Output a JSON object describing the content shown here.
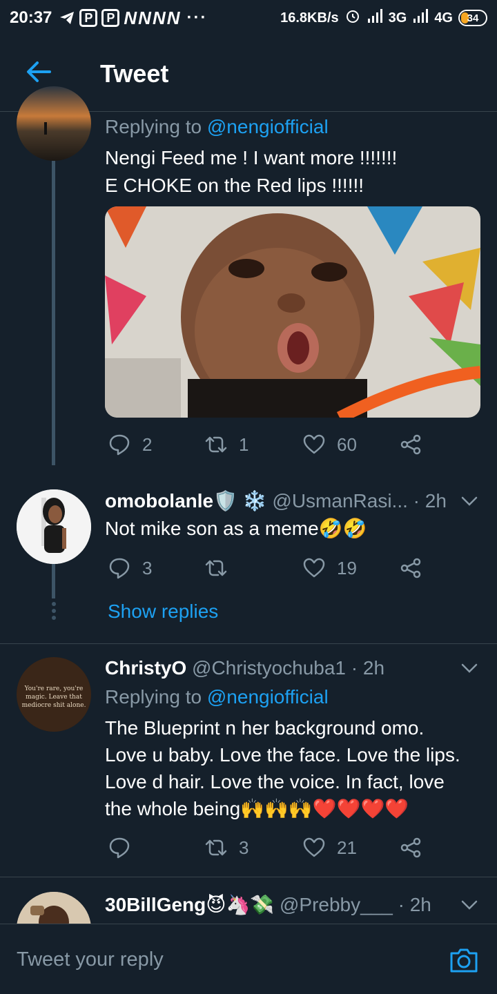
{
  "status_bar": {
    "time": "20:37",
    "p_icons": [
      "P",
      "P"
    ],
    "n_icons": [
      "N",
      "N",
      "N",
      "N"
    ],
    "dots": "···",
    "speed": "16.8KB/s",
    "network1": "3G",
    "network2": "4G",
    "battery": "34"
  },
  "header": {
    "title": "Tweet"
  },
  "tweets": [
    {
      "replying_prefix": "Replying to",
      "replying_handle": "@nengiofficial",
      "text_lines": [
        "Nengi Feed me ! I want more !!!!!!!",
        "E CHOKE on the Red lips !!!!!!"
      ],
      "replies": "2",
      "retweets": "1",
      "likes": "60"
    },
    {
      "name": "omobolanle🛡️ ❄️",
      "handle": "@UsmanRasi...",
      "time": "· 2h",
      "text": "Not mike son as a meme🤣🤣",
      "replies": "3",
      "retweets": "",
      "likes": "19",
      "show_replies": "Show replies"
    },
    {
      "name": "ChristyO",
      "handle": "@Christyochuba1",
      "time": "· 2h",
      "replying_prefix": "Replying to",
      "replying_handle": "@nengiofficial",
      "avatar_text": [
        "You're rare, you're",
        "magic. Leave that",
        "mediocre shit alone."
      ],
      "text_lines": [
        "The Blueprint n her background omo.",
        "Love u baby. Love the face. Love the lips.",
        "Love d hair. Love the voice. In fact, love",
        "the whole being🙌🙌🙌❤️❤️❤️❤️"
      ],
      "replies": "",
      "retweets": "3",
      "likes": "21"
    },
    {
      "name": "30BillGeng😈🦄💸",
      "handle": "@Prebby___",
      "time": "· 2h"
    }
  ],
  "composer": {
    "placeholder": "Tweet your reply"
  },
  "colors": {
    "background": "#15202b",
    "accent": "#1da1f2",
    "muted": "#8899a6",
    "divider": "#38444d"
  }
}
